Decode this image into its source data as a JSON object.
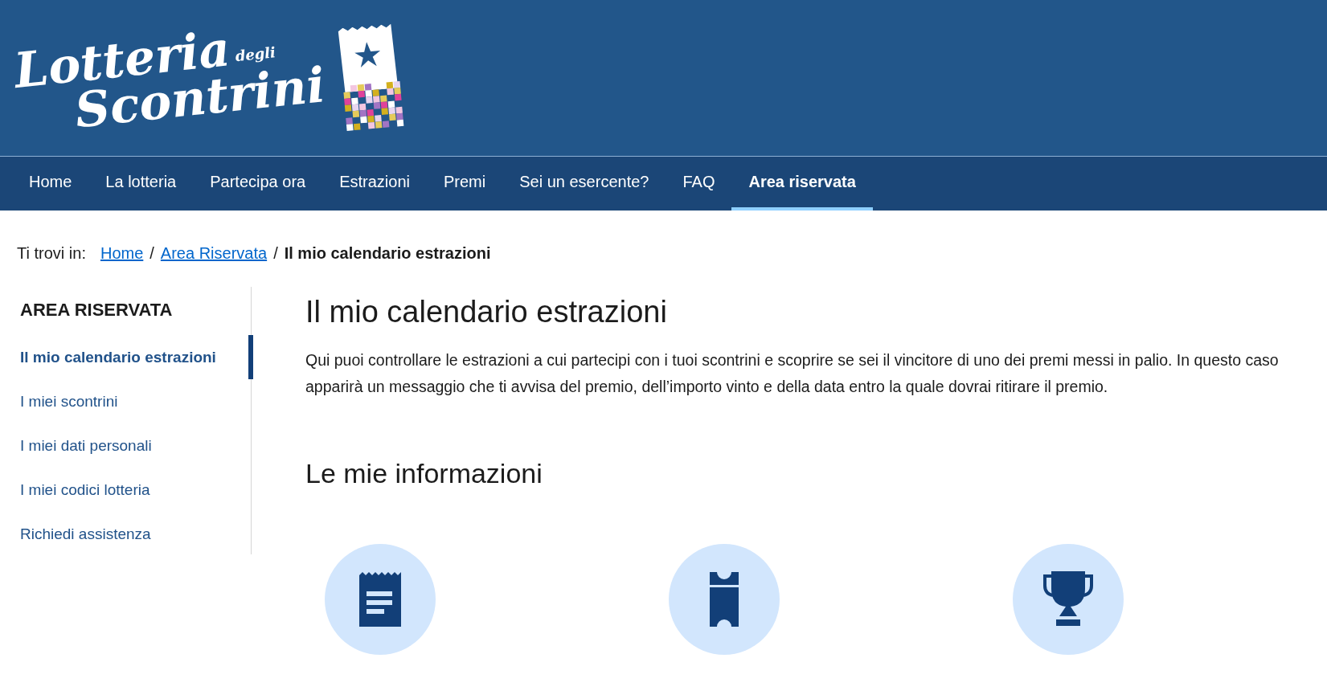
{
  "logo": {
    "line_1": "Lotteria",
    "small": "degli",
    "line_2": "Scontrini"
  },
  "nav": [
    {
      "label": "Home",
      "selected": false
    },
    {
      "label": "La lotteria",
      "selected": false
    },
    {
      "label": "Partecipa ora",
      "selected": false
    },
    {
      "label": "Estrazioni",
      "selected": false
    },
    {
      "label": "Premi",
      "selected": false
    },
    {
      "label": "Sei un esercente?",
      "selected": false
    },
    {
      "label": "FAQ",
      "selected": false
    },
    {
      "label": "Area riservata",
      "selected": true
    }
  ],
  "breadcrumb": {
    "prefix": "Ti trovi in:",
    "links": [
      "Home",
      "Area Riservata"
    ],
    "separator": "/",
    "current": "Il mio calendario estrazioni"
  },
  "sidebar": {
    "title": "AREA RISERVATA",
    "items": [
      {
        "label": "Il mio calendario estrazioni",
        "selected": true
      },
      {
        "label": "I miei scontrini",
        "selected": false
      },
      {
        "label": "I miei dati personali",
        "selected": false
      },
      {
        "label": "I miei codici lotteria",
        "selected": false
      },
      {
        "label": "Richiedi assistenza",
        "selected": false
      }
    ]
  },
  "main": {
    "title": "Il mio calendario estrazioni",
    "intro": "Qui puoi controllare le estrazioni a cui partecipi con i tuoi scontrini e scoprire se sei il vincitore di uno dei premi messi in palio. In questo caso apparirà un messaggio che ti avvisa del premio, dell’importo vinto e della data entro la quale dovrai ritirare il premio.",
    "section_title": "Le mie informazioni",
    "info_icons": [
      {
        "kind": "receipt"
      },
      {
        "kind": "ticket"
      },
      {
        "kind": "trophy"
      }
    ]
  }
}
